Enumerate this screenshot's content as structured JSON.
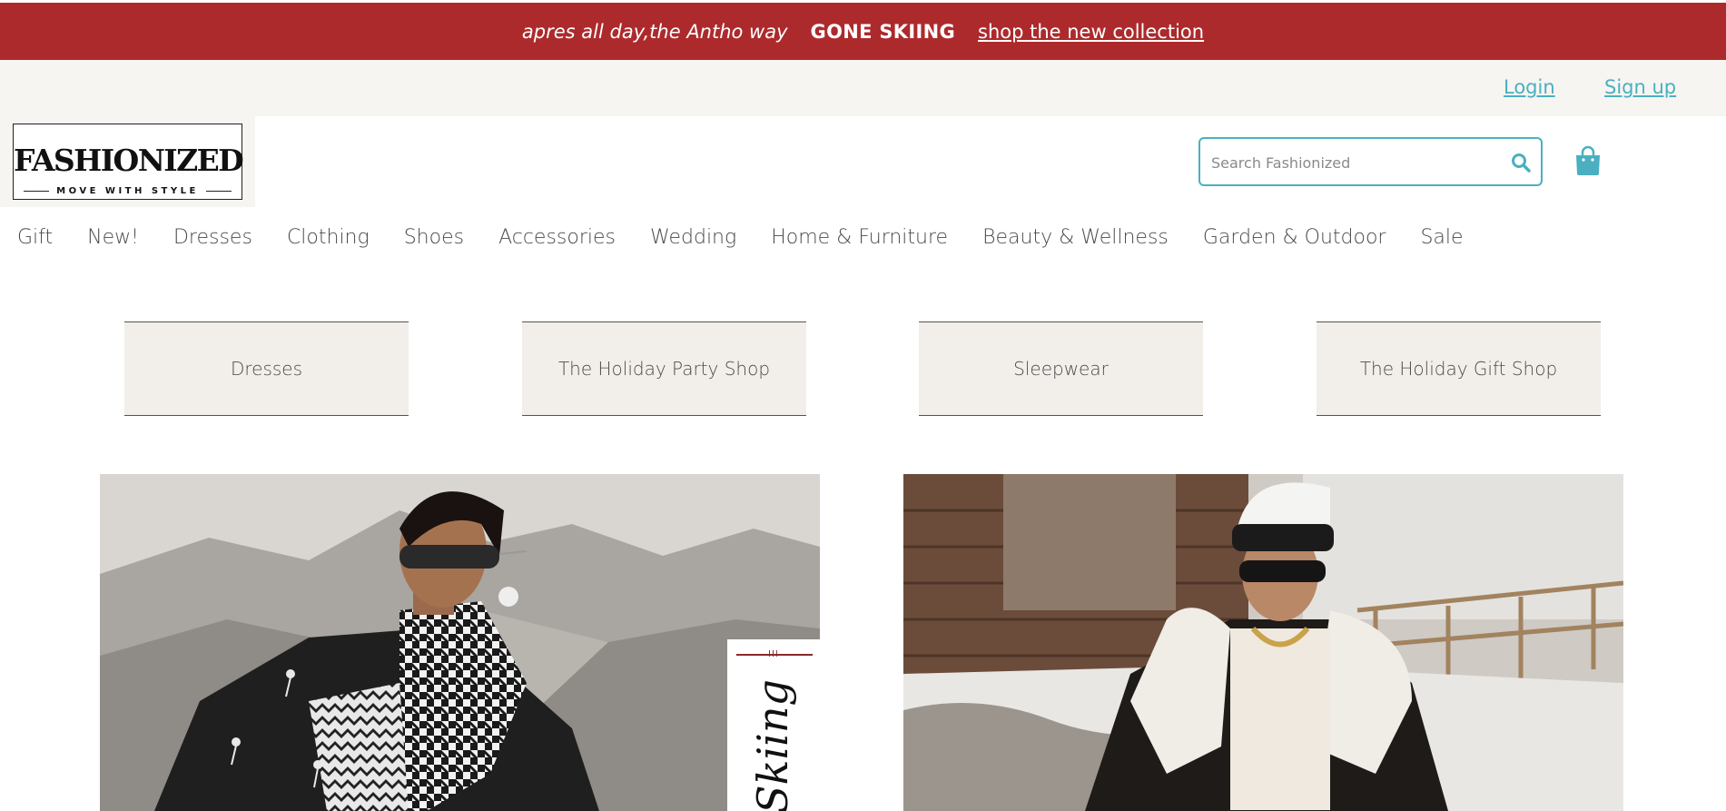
{
  "promo": {
    "tagline": "apres all day,the Antho way",
    "headline": "GONE SKIING",
    "cta": "shop the new collection"
  },
  "account": {
    "login": "Login",
    "signup": "Sign up"
  },
  "logo": {
    "name": "FASHIONIZED",
    "tagline": "MOVE WITH STYLE"
  },
  "search": {
    "placeholder": "Search Fashionized",
    "icon": "search-icon"
  },
  "cart": {
    "icon": "shopping-bag-icon"
  },
  "nav": {
    "items": [
      "Gift",
      "New!",
      "Dresses",
      "Clothing",
      "Shoes",
      "Accessories",
      "Wedding",
      "Home & Furniture",
      "Beauty & Wellness",
      "Garden & Outdoor",
      "Sale"
    ]
  },
  "categories": [
    "Dresses",
    "The Holiday Party Shop",
    "Sleepwear",
    "The Holiday Gift Shop"
  ],
  "hero": {
    "badge_mark": "III",
    "badge_word": "Skiing"
  },
  "colors": {
    "promo_bg": "#ad2a2c",
    "accent": "#4ab0c1",
    "tile_bg": "#f2efeb",
    "account_bg": "#f7f5f1"
  }
}
